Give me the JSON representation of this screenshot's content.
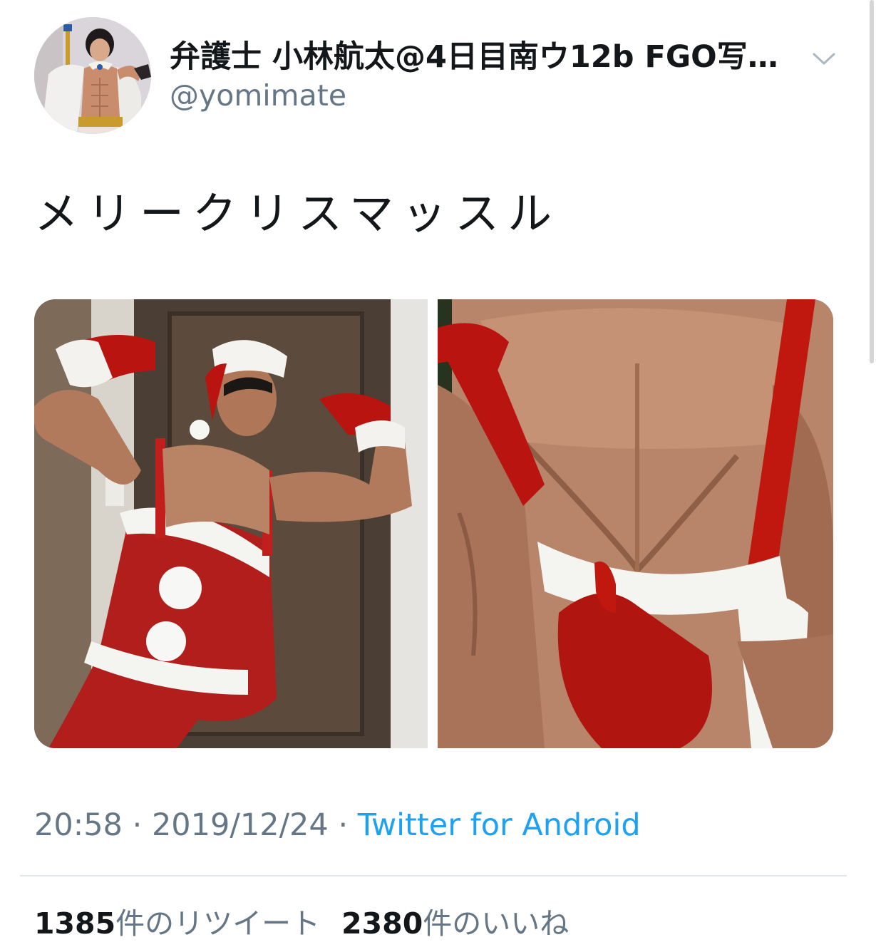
{
  "user": {
    "display_name": "弁護士 小林航太@4日目南ウ12b FGO写…",
    "handle": "@yomimate",
    "avatar_icon": "profile-avatar"
  },
  "menu_icon": "chevron-down-icon",
  "tweet": {
    "text": "メリークリスマッスル",
    "media_count": 2
  },
  "meta": {
    "time": "20:58",
    "separator": " · ",
    "date": "2019/12/24",
    "source": "Twitter for Android"
  },
  "stats": {
    "retweets_count": "1385",
    "retweets_label": "件のリツイート",
    "likes_count": "2380",
    "likes_label": "件のいいね"
  },
  "colors": {
    "link": "#1da1f2",
    "secondary_text": "#657786",
    "primary_text": "#14171a",
    "divider": "#e1e8ed"
  }
}
